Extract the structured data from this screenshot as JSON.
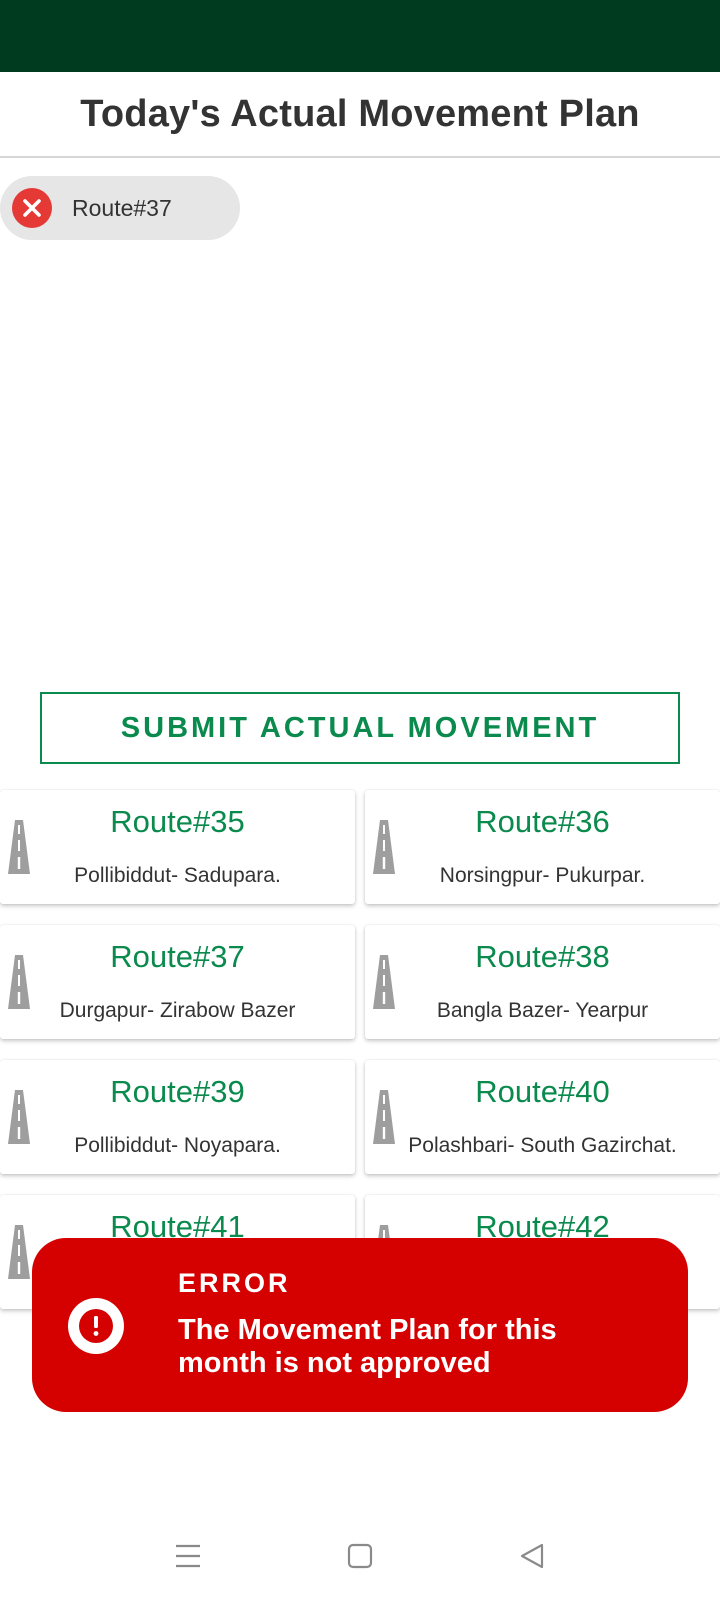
{
  "header": {
    "title": "Today's Actual Movement Plan"
  },
  "selected_chip": {
    "label": "Route#37",
    "remove_icon": "close-circle-icon"
  },
  "submit_button": {
    "label": "SUBMIT ACTUAL MOVEMENT"
  },
  "routes": [
    {
      "title": "Route#35",
      "area": "Pollibiddut- Sadupara."
    },
    {
      "title": "Route#36",
      "area": "Norsingpur- Pukurpar."
    },
    {
      "title": "Route#37",
      "area": "Durgapur- Zirabow Bazer"
    },
    {
      "title": "Route#38",
      "area": "Bangla Bazer-  Yearpur"
    },
    {
      "title": "Route#39",
      "area": "Pollibiddut- Noyapara."
    },
    {
      "title": "Route#40",
      "area": "Polashbari- South Gazirchat."
    },
    {
      "title": "Route#41",
      "area": ""
    },
    {
      "title": "Route#42",
      "area": ""
    }
  ],
  "toast": {
    "title": "ERROR",
    "message": "The Movement Plan for this month is not approved",
    "icon": "alert-circle-icon"
  },
  "colors": {
    "status_bar": "#003a1f",
    "accent_green": "#0a8a4d",
    "error_red": "#d50000",
    "chip_close_red": "#e53935"
  }
}
